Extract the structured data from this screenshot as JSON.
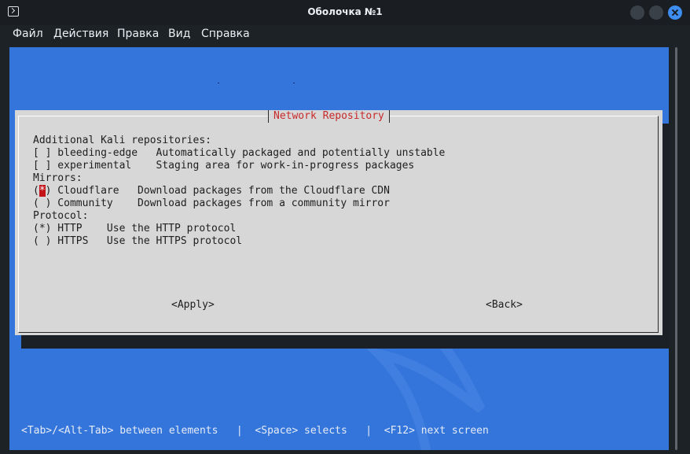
{
  "window": {
    "title": "Оболочка №1",
    "icon": "terminal-icon",
    "controls": [
      "minimize-button",
      "maximize-button",
      "close-button"
    ],
    "accent_color": "#3d8ef0"
  },
  "menu": {
    "items": [
      "Файл",
      "Действия",
      "Правка",
      "Вид",
      "Справка"
    ]
  },
  "terminal": {
    "background_color": "#3475dc",
    "dialog": {
      "title": "Network Repository",
      "lines": [
        {
          "prefix": "",
          "cursor": "",
          "suffix": "Additional Kali repositories:"
        },
        {
          "prefix": "[ ] bleeding-edge   Automatically packaged and potentially unstable",
          "cursor": "",
          "suffix": ""
        },
        {
          "prefix": "[ ] experimental    Staging area for work-in-progress packages",
          "cursor": "",
          "suffix": ""
        },
        {
          "prefix": "Mirrors:",
          "cursor": "",
          "suffix": ""
        },
        {
          "prefix": "(",
          "cursor": "*",
          "suffix": ") Cloudflare   Download packages from the Cloudflare CDN"
        },
        {
          "prefix": "( ) Community    Download packages from a community mirror",
          "cursor": "",
          "suffix": ""
        },
        {
          "prefix": "Protocol:",
          "cursor": "",
          "suffix": ""
        },
        {
          "prefix": "(*) HTTP    Use the HTTP protocol",
          "cursor": "",
          "suffix": ""
        },
        {
          "prefix": "( ) HTTPS   Use the HTTPS protocol",
          "cursor": "",
          "suffix": ""
        }
      ],
      "apply_label": "<Apply>",
      "back_label": "<Back>"
    },
    "status_line": "<Tab>/<Alt-Tab> between elements   |  <Space> selects   |  <F12> next screen"
  }
}
